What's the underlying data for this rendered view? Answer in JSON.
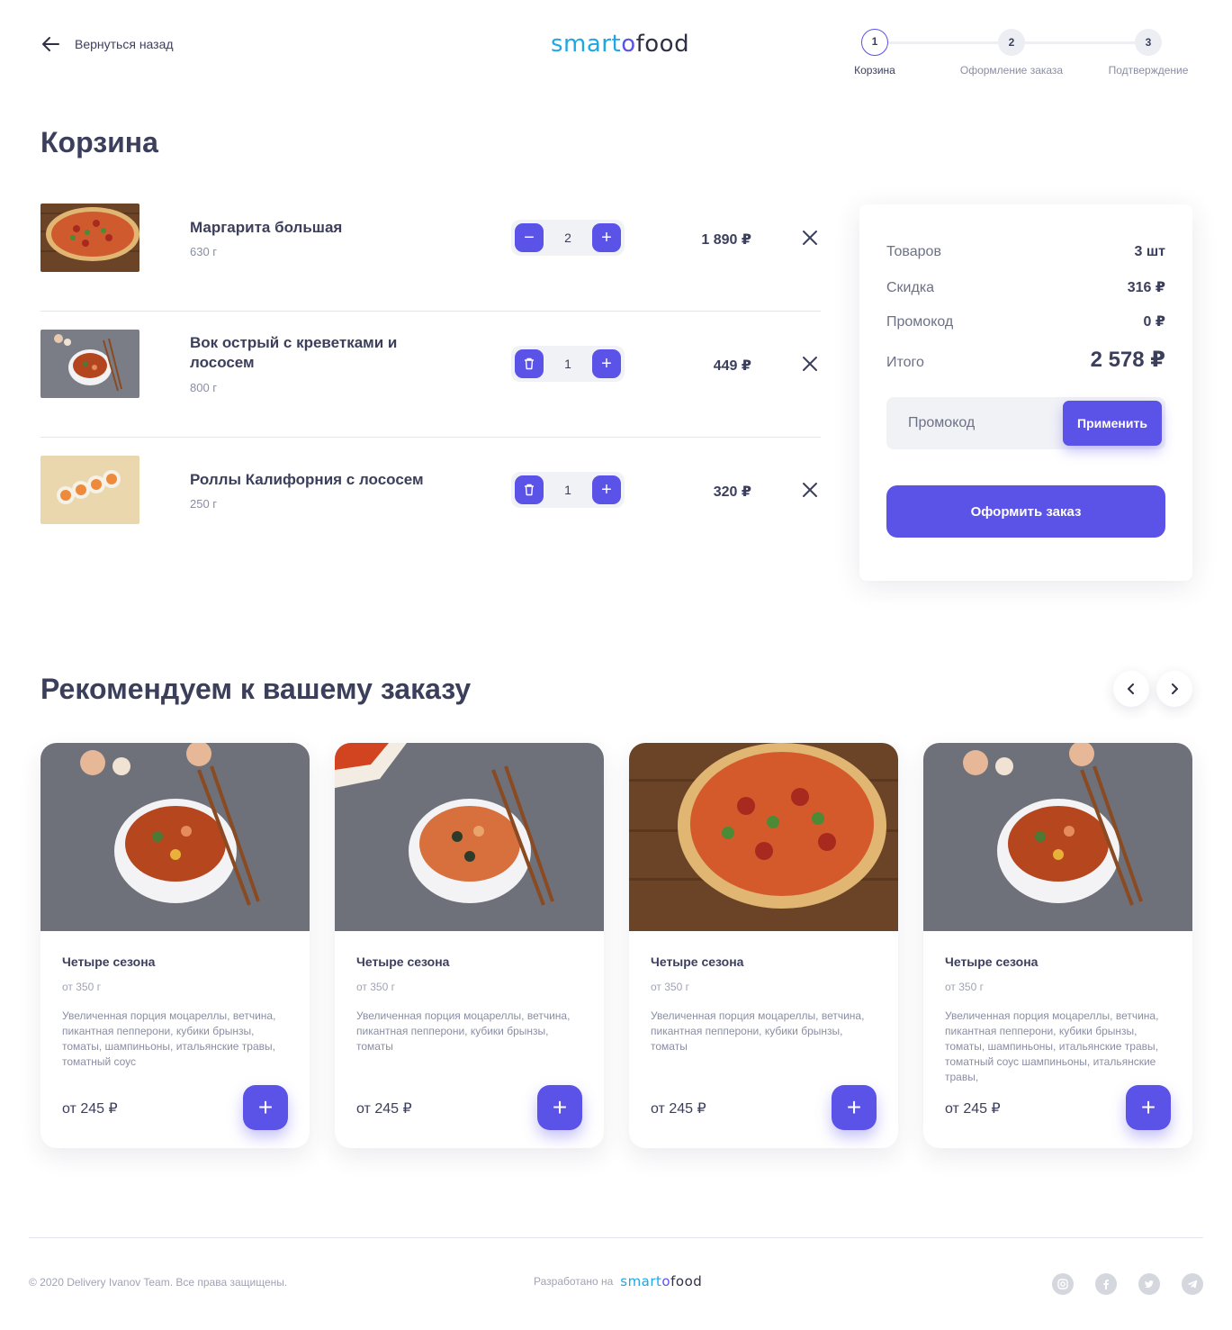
{
  "header": {
    "back_label": "Вернуться назад",
    "logo": {
      "part1": "smart",
      "part2": "o",
      "part3": "food"
    },
    "steps": [
      {
        "num": "1",
        "label": "Корзина"
      },
      {
        "num": "2",
        "label": "Оформление заказа"
      },
      {
        "num": "3",
        "label": "Подтверждение"
      }
    ]
  },
  "cart": {
    "title": "Корзина",
    "items": [
      {
        "name": "Маргарита большая",
        "weight": "630 г",
        "qty": "2",
        "price": "1 890 ₽"
      },
      {
        "name": "Вок острый с креветками и лососем",
        "weight": "800 г",
        "qty": "1",
        "price": "449 ₽"
      },
      {
        "name": "Роллы Калифорния с лососем",
        "weight": "250 г",
        "qty": "1",
        "price": "320 ₽"
      }
    ]
  },
  "summary": {
    "items_label": "Товаров",
    "items_value": "3 шт",
    "discount_label": "Скидка",
    "discount_value": "316 ₽",
    "promo_label": "Промокод",
    "promo_value": "0 ₽",
    "total_label": "Итого",
    "total_value": "2 578 ₽",
    "promo_placeholder": "Промокод",
    "apply_label": "Применить",
    "checkout_label": "Оформить заказ"
  },
  "recommend": {
    "title": "Рекомендуем к вашему заказу",
    "cards": [
      {
        "title": "Четыре сезона",
        "weight": "от 350 г",
        "desc": "Увеличенная порция моцареллы, ветчина, пикантная пепперони, кубики брынзы, томаты, шампиньоны, итальянские травы, томатный соус",
        "price": "от 245 ₽"
      },
      {
        "title": "Четыре сезона",
        "weight": "от 350 г",
        "desc": "Увеличенная порция моцареллы, ветчина, пикантная пепперони, кубики брынзы, томаты",
        "price": "от 245 ₽"
      },
      {
        "title": "Четыре сезона",
        "weight": "от 350 г",
        "desc": "Увеличенная порция моцареллы, ветчина, пикантная пепперони, кубики брынзы, томаты",
        "price": "от 245 ₽"
      },
      {
        "title": "Четыре сезона",
        "weight": "от 350 г",
        "desc": "Увеличенная порция моцареллы, ветчина, пикантная пепперони, кубики брынзы, томаты, шампиньоны, итальянские травы, томатный соус шампиньоны, итальянские травы,",
        "price": "от 245 ₽"
      }
    ]
  },
  "footer": {
    "copyright": "© 2020 Delivery Ivanov Team. Все права защищены.",
    "developed_by": "Разработано на",
    "socials": [
      "instagram-icon",
      "facebook-icon",
      "twitter-icon",
      "telegram-icon"
    ]
  },
  "colors": {
    "accent": "#5b52e8",
    "logo_blue": "#1ea7e3",
    "text": "#3b3f5c",
    "muted": "#8a8ea3"
  }
}
